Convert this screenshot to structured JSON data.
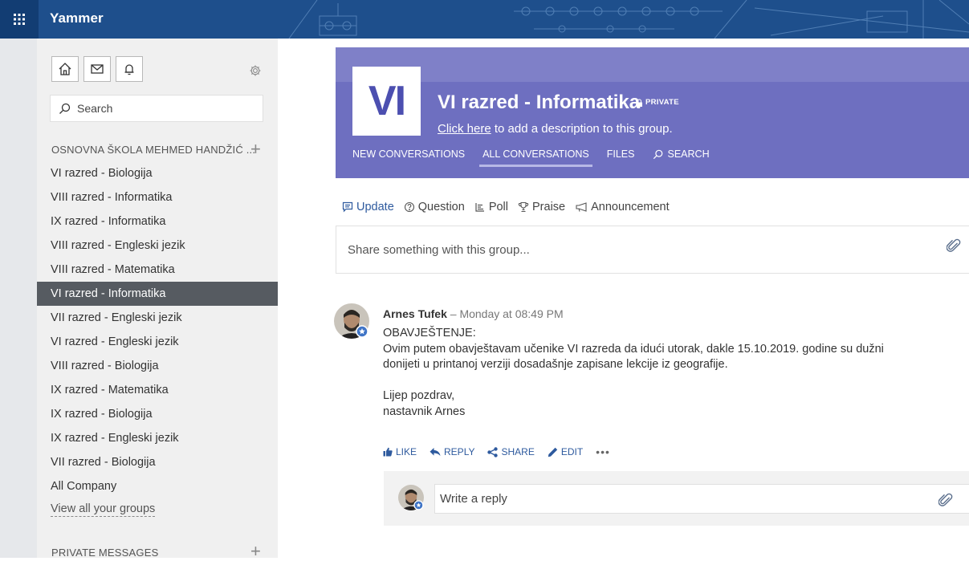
{
  "app": {
    "name": "Yammer"
  },
  "nav": {
    "home_icon": "home-icon",
    "mail_icon": "mail-icon",
    "bell_icon": "bell-icon",
    "settings_icon": "gear-icon"
  },
  "search": {
    "placeholder": "Search"
  },
  "network": {
    "name": "OSNOVNA ŠKOLA MEHMED HANDŽIĆ ...",
    "groups": [
      "VI razred - Biologija",
      "VIII razred - Informatika",
      "IX razred - Informatika",
      "VIII razred - Engleski jezik",
      "VIII razred - Matematika",
      "VI razred - Informatika",
      "VII razred - Engleski jezik",
      "VI razred - Engleski jezik",
      "VIII razred - Biologija",
      "IX razred - Matematika",
      "IX razred - Biologija",
      "IX razred - Engleski jezik",
      "VII razred - Biologija",
      "All Company"
    ],
    "active_index": 5,
    "view_all": "View all your groups"
  },
  "private_messages": {
    "label": "PRIVATE MESSAGES"
  },
  "group": {
    "logo_text": "VI",
    "title": "VI razred - Informatika",
    "private_label": "PRIVATE",
    "desc_link": "Click here",
    "desc_rest": " to add a description to this group.",
    "tabs": [
      "NEW CONVERSATIONS",
      "ALL CONVERSATIONS",
      "FILES",
      "SEARCH"
    ],
    "active_tab": 1
  },
  "publisher": {
    "tabs": [
      "Update",
      "Question",
      "Poll",
      "Praise",
      "Announcement"
    ],
    "active_tab": 0,
    "placeholder": "Share something with this group..."
  },
  "post": {
    "author": "Arnes Tufek",
    "time": " – Monday at 08:49 PM",
    "lines": [
      "OBAVJEŠTENJE:",
      "Ovim putem obavještavam učenike VI razreda da idući utorak, dakle 15.10.2019. godine su dužni",
      "donijeti u printanoj verziji dosadašnje zapisane lekcije iz geografije.",
      "",
      "Lijep pozdrav,",
      "nastavnik Arnes"
    ],
    "actions": [
      "LIKE",
      "REPLY",
      "SHARE",
      "EDIT"
    ],
    "more": "•••"
  },
  "reply": {
    "placeholder": "Write a reply"
  },
  "colors": {
    "topbar": "#1e4f8c",
    "group_header": "#6e6fc0",
    "active_group": "#565b61",
    "link_blue": "#2e5a9e"
  }
}
